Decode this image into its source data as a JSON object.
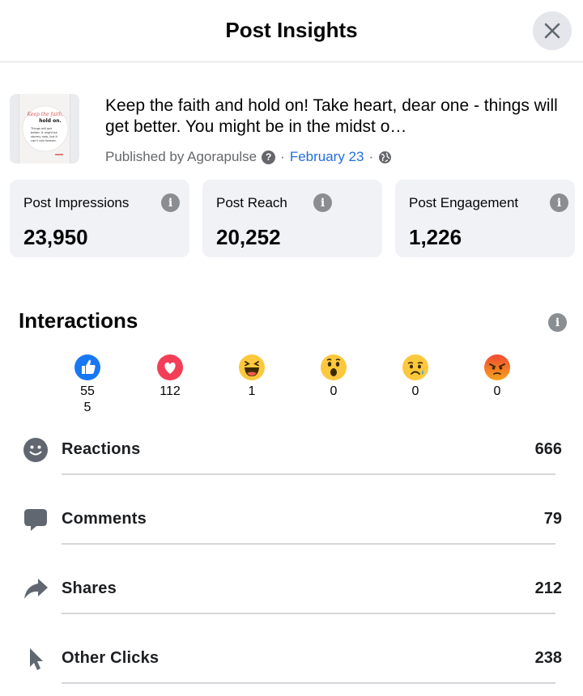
{
  "header": {
    "title": "Post Insights"
  },
  "post": {
    "text": "Keep the faith and hold on! Take heart, dear one - things will get better. You might be in the midst o…",
    "published_by": "Published by Agorapulse",
    "help_glyph": "?",
    "separator": "·",
    "date": "February 23",
    "thumbnail": {
      "script_title": "Keep the faith,",
      "bold_line": "hold on.",
      "body_lines": [
        "Things will get",
        "better. It might be",
        "stormy now, but it",
        "can't rain forever."
      ]
    }
  },
  "metrics": [
    {
      "label": "Post Impressions",
      "value": "23,950"
    },
    {
      "label": "Post Reach",
      "value": "20,252"
    },
    {
      "label": "Post Engagement",
      "value": "1,226"
    }
  ],
  "interactions": {
    "title": "Interactions",
    "reactions": [
      {
        "name": "like",
        "count_line1": "55",
        "count_line2": "5"
      },
      {
        "name": "love",
        "count_line1": "112"
      },
      {
        "name": "haha",
        "count_line1": "1"
      },
      {
        "name": "wow",
        "count_line1": "0"
      },
      {
        "name": "sad",
        "count_line1": "0"
      },
      {
        "name": "angry",
        "count_line1": "0"
      }
    ],
    "rows": [
      {
        "label": "Reactions",
        "value": "666",
        "icon": "smiley-icon"
      },
      {
        "label": "Comments",
        "value": "79",
        "icon": "comment-icon"
      },
      {
        "label": "Shares",
        "value": "212",
        "icon": "share-icon"
      },
      {
        "label": "Other Clicks",
        "value": "238",
        "icon": "cursor-icon"
      }
    ]
  },
  "colors": {
    "accent_link": "#216fdb",
    "like_blue": "#1877f2",
    "love_red": "#f33e58",
    "emoji_yellow": "#fcc83d",
    "angry_red": "#e9710f"
  }
}
